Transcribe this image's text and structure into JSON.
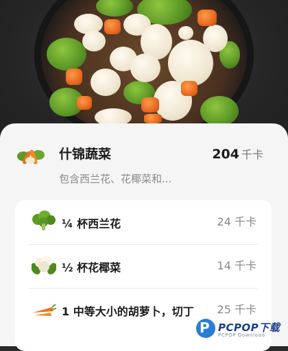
{
  "dish": {
    "title": "什锦蔬菜",
    "kcal": "204",
    "kcal_unit": "千卡",
    "description": "包含西兰花、花椰菜和..."
  },
  "ingredients": [
    {
      "label": "¼ 杯西兰花",
      "kcal": "24 千卡",
      "icon": "broccoli-icon"
    },
    {
      "label": "½ 杯花椰菜",
      "kcal": "14 千卡",
      "icon": "cauliflower-icon"
    },
    {
      "label": "1 中等大小的胡萝卜，切丁",
      "kcal": "25 千卡",
      "icon": "carrot-icon"
    }
  ],
  "watermark": {
    "brand": "PCPOP下载",
    "sub": "PCPOP Download",
    "logo_letter": "P"
  }
}
